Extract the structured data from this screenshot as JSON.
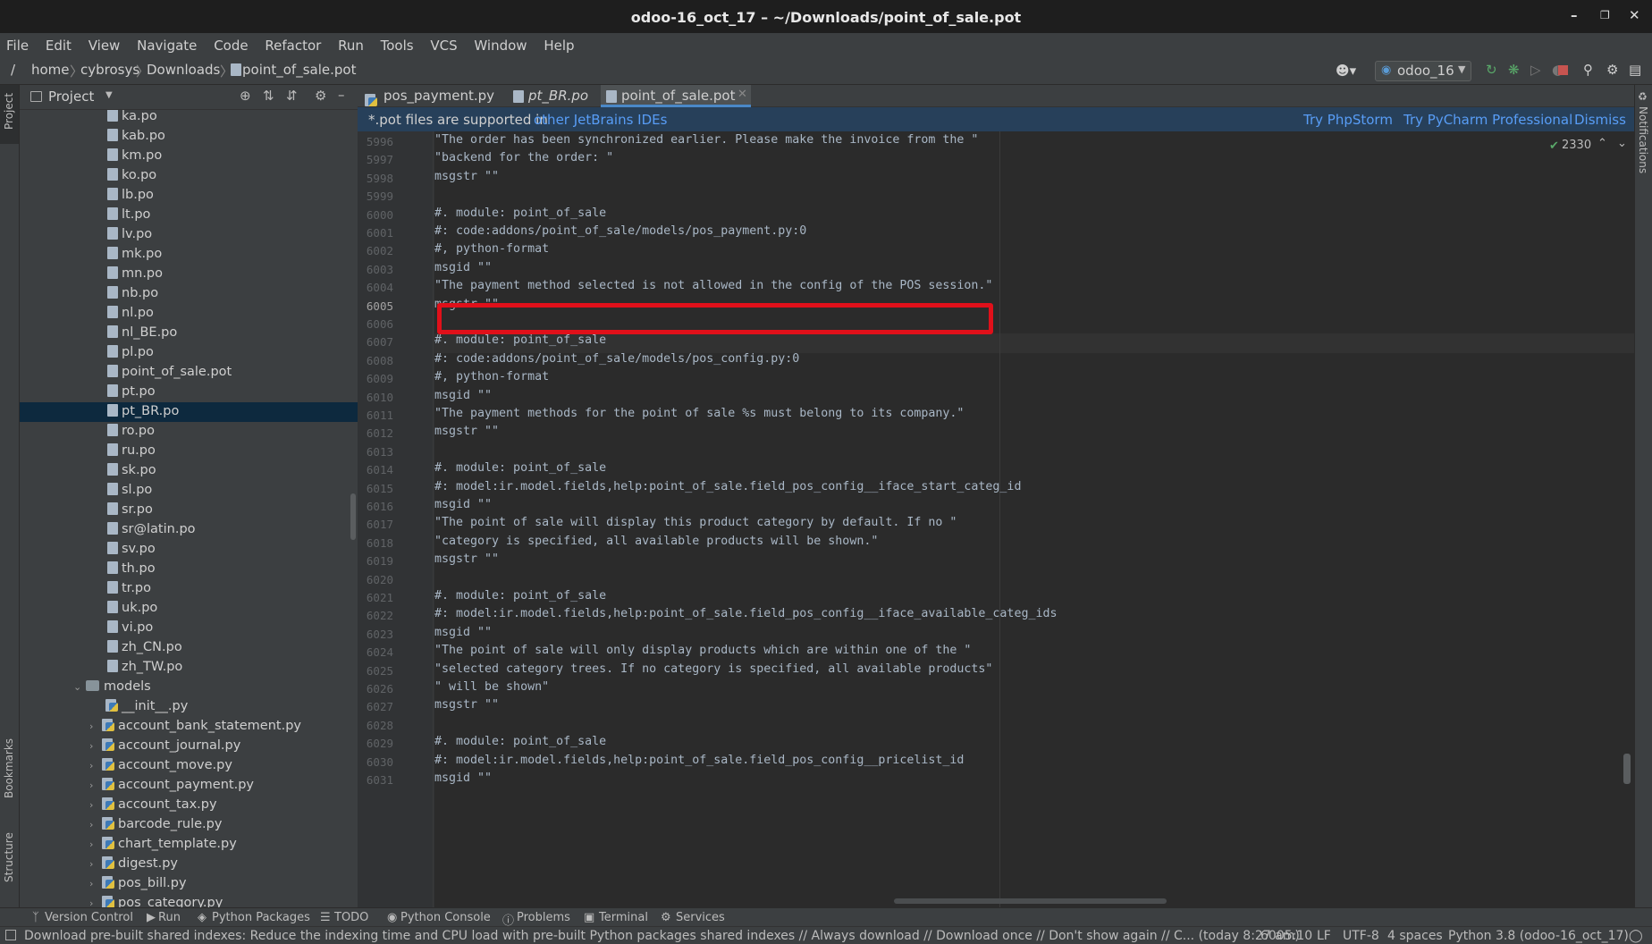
{
  "window": {
    "title": "odoo-16_oct_17 – ~/Downloads/point_of_sale.pot"
  },
  "menu": [
    "File",
    "Edit",
    "View",
    "Navigate",
    "Code",
    "Refactor",
    "Run",
    "Tools",
    "VCS",
    "Window",
    "Help"
  ],
  "breadcrumb": [
    "/",
    "home",
    "cybrosys",
    "Downloads",
    "point_of_sale.pot"
  ],
  "run_config": "odoo_16",
  "sidebar": {
    "left_tabs": [
      "Project",
      "Bookmarks",
      "Structure"
    ],
    "right_tabs": [
      "Notifications"
    ]
  },
  "project": {
    "header": "Project",
    "files": [
      "ka.po",
      "kab.po",
      "km.po",
      "ko.po",
      "lb.po",
      "lt.po",
      "lv.po",
      "mk.po",
      "mn.po",
      "nb.po",
      "nl.po",
      "nl_BE.po",
      "pl.po",
      "point_of_sale.pot",
      "pt.po",
      "pt_BR.po",
      "ro.po",
      "ru.po",
      "sk.po",
      "sl.po",
      "sr.po",
      "sr@latin.po",
      "sv.po",
      "th.po",
      "tr.po",
      "uk.po",
      "vi.po",
      "zh_CN.po",
      "zh_TW.po"
    ],
    "selected": "pt_BR.po",
    "folder": "models",
    "py_files": [
      "__init__.py",
      "account_bank_statement.py",
      "account_journal.py",
      "account_move.py",
      "account_payment.py",
      "account_tax.py",
      "barcode_rule.py",
      "chart_template.py",
      "digest.py",
      "pos_bill.py",
      "pos_category.py"
    ]
  },
  "tabs": [
    {
      "label": "pos_payment.py",
      "active": false
    },
    {
      "label": "pt_BR.po",
      "active": false
    },
    {
      "label": "point_of_sale.pot",
      "active": true
    }
  ],
  "banner": {
    "text": "*.pot files are supported in",
    "link": "other JetBrains IDEs",
    "actions": [
      "Try PhpStorm",
      "Try PyCharm Professional",
      "Dismiss"
    ]
  },
  "inspection_count": "2330",
  "editor": {
    "current_line": "6005",
    "lines": [
      {
        "n": "5996",
        "text": "\"The order has been synchronized earlier. Please make the invoice from the \""
      },
      {
        "n": "5997",
        "text": "\"backend for the order: \""
      },
      {
        "n": "5998",
        "text": "msgstr \"\""
      },
      {
        "n": "5999",
        "text": ""
      },
      {
        "n": "6000",
        "text": "#. module: point_of_sale"
      },
      {
        "n": "6001",
        "text": "#: code:addons/point_of_sale/models/pos_payment.py:0"
      },
      {
        "n": "6002",
        "text": "#, python-format"
      },
      {
        "n": "6003",
        "text": "msgid \"\""
      },
      {
        "n": "6004",
        "text": "\"The payment method selected is not allowed in the config of the POS session.\""
      },
      {
        "n": "6005",
        "text": "msgstr \"\""
      },
      {
        "n": "6006",
        "text": ""
      },
      {
        "n": "6007",
        "text": "#. module: point_of_sale"
      },
      {
        "n": "6008",
        "text": "#: code:addons/point_of_sale/models/pos_config.py:0"
      },
      {
        "n": "6009",
        "text": "#, python-format"
      },
      {
        "n": "6010",
        "text": "msgid \"\""
      },
      {
        "n": "6011",
        "text": "\"The payment methods for the point of sale %s must belong to its company.\""
      },
      {
        "n": "6012",
        "text": "msgstr \"\""
      },
      {
        "n": "6013",
        "text": ""
      },
      {
        "n": "6014",
        "text": "#. module: point_of_sale"
      },
      {
        "n": "6015",
        "text": "#: model:ir.model.fields,help:point_of_sale.field_pos_config__iface_start_categ_id"
      },
      {
        "n": "6016",
        "text": "msgid \"\""
      },
      {
        "n": "6017",
        "text": "\"The point of sale will display this product category by default. If no \""
      },
      {
        "n": "6018",
        "text": "\"category is specified, all available products will be shown.\""
      },
      {
        "n": "6019",
        "text": "msgstr \"\""
      },
      {
        "n": "6020",
        "text": ""
      },
      {
        "n": "6021",
        "text": "#. module: point_of_sale"
      },
      {
        "n": "6022",
        "text": "#: model:ir.model.fields,help:point_of_sale.field_pos_config__iface_available_categ_ids"
      },
      {
        "n": "6023",
        "text": "msgid \"\""
      },
      {
        "n": "6024",
        "text": "\"The point of sale will only display products which are within one of the \""
      },
      {
        "n": "6025",
        "text": "\"selected category trees. If no category is specified, all available products\""
      },
      {
        "n": "6026",
        "text": "\" will be shown\""
      },
      {
        "n": "6027",
        "text": "msgstr \"\""
      },
      {
        "n": "6028",
        "text": ""
      },
      {
        "n": "6029",
        "text": "#. module: point_of_sale"
      },
      {
        "n": "6030",
        "text": "#: model:ir.model.fields,help:point_of_sale.field_pos_config__pricelist_id"
      },
      {
        "n": "6031",
        "text": "msgid \"\""
      }
    ]
  },
  "toolwindows": [
    "Version Control",
    "Run",
    "Python Packages",
    "TODO",
    "Python Console",
    "Problems",
    "Terminal",
    "Services"
  ],
  "status": {
    "message": "Download pre-built shared indexes: Reduce the indexing time and CPU load with pre-built Python packages shared indexes // Always download // Download once // Don't show again // C... (today 8:27 am)",
    "position": "6005:10",
    "line_sep": "LF",
    "encoding": "UTF-8",
    "indent": "4 spaces",
    "interpreter": "Python 3.8 (odoo-16_oct_17)"
  },
  "colors": {
    "accent": "#4a88c7",
    "highlight_box": "#e0101a",
    "selection": "#0d293e",
    "link": "#589df6"
  }
}
